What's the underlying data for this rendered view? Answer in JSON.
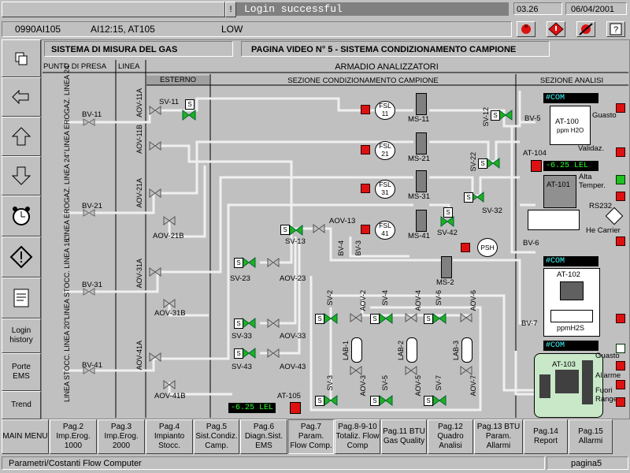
{
  "header": {
    "message": "Login successful",
    "time": "03.26",
    "date": "06/04/2001",
    "msg_marker": "!"
  },
  "alarm_row": {
    "code": "0990AI105",
    "tags": "AI12:15, AT105",
    "level": "LOW"
  },
  "titles": {
    "system": "SISTEMA DI MISURA  DEL GAS",
    "page": "PAGINA VIDEO N° 5 - SISTEMA CONDIZIONAMENTO CAMPIONE",
    "cabinet": "ARMADIO ANALIZZATORI",
    "punto": "PUNTO DI PRESA",
    "linea": "LINEA",
    "esterno": "ESTERNO",
    "sezione_cond": "SEZIONE CONDIZIONAMENTO CAMPIONE",
    "sezione_analisi": "SEZIONE ANALISI"
  },
  "lines": [
    "LINEA EROGAZ. LINEA 24\"",
    "LINEA EROGAZ. LINEA 24\"",
    "LINEA STOCC. LINEA 16\"",
    "LINEA STOCC. LINEA 20\""
  ],
  "labels": {
    "bv11": "BV-11",
    "bv21": "BV-21",
    "bv31": "BV-31",
    "bv41": "BV-41",
    "aov11a": "AOV-11A",
    "aov11b": "AOV-11B",
    "aov21a": "AOV-21A",
    "aov21b": "AOV-21B",
    "aov31a": "AOV-31A",
    "aov31b": "AOV-31B",
    "aov41a": "AOV-41A",
    "aov41b": "AOV-41B",
    "sv11": "SV-11",
    "sv13": "SV-13",
    "sv23": "SV-23",
    "sv33": "SV-33",
    "sv43": "SV-43",
    "aov23": "AOV-23",
    "aov33": "AOV-33",
    "aov43": "AOV-43",
    "aov13": "AOV-13",
    "bv4": "BV-4",
    "bv3": "BV-3",
    "fsl11": "FSL 11",
    "fsl21": "FSL 21",
    "fsl31": "FSL 31",
    "fsl41": "FSL 41",
    "ms11": "MS-11",
    "ms21": "MS-21",
    "ms31": "MS-31",
    "ms41": "MS-41",
    "ms2": "MS-2",
    "sv12": "SV-12",
    "sv22": "SV-22",
    "sv32": "SV-32",
    "sv42": "SV-42",
    "psh": "PSH",
    "sv2": "SV-2",
    "sv4": "SV-4",
    "sv6": "SV-6",
    "sv3": "SV-3",
    "sv5": "SV-5",
    "sv7": "SV-7",
    "aov2": "AOV-2",
    "aov4": "AOV-4",
    "aov6": "AOV-6",
    "aov3": "AOV-3",
    "aov5": "AOV-5",
    "aov7": "AOV-7",
    "lab1": "LAB-1",
    "lab2": "LAB-2",
    "lab3": "LAB-3",
    "at105": "AT-105",
    "at105_val": "-6.25 LEL",
    "bv5": "BV-5",
    "bv6": "BV-6",
    "bv7": "BV-7",
    "com1": "#COM",
    "com2": "#COM",
    "com3": "#COM",
    "at100": "AT-100",
    "ppmh2o": "ppm H2O",
    "guasto1": "Guasto",
    "validaz": "Validaz.",
    "at104": "AT-104",
    "at104_val": "-6.25 LEL",
    "at101": "AT-101",
    "alta_temper": "Alta Temper.",
    "rs232": "RS232",
    "he_carrier": "He Carrier",
    "at102": "AT-102",
    "ppmh2s": "ppmH2S",
    "at103": "AT-103",
    "guasto2": "Guasto",
    "allarme": "Allarme",
    "fuori_range": "Fuori Range"
  },
  "sidebar": [
    {
      "id": "copy",
      "label": "",
      "icon": "copy-icon"
    },
    {
      "id": "back",
      "label": "",
      "icon": "back-arrow-icon"
    },
    {
      "id": "up",
      "label": "",
      "icon": "up-arrow-icon"
    },
    {
      "id": "down",
      "label": "",
      "icon": "down-arrow-icon"
    },
    {
      "id": "alarm",
      "label": "",
      "icon": "alarm-clock-icon"
    },
    {
      "id": "warn",
      "label": "",
      "icon": "warning-icon"
    },
    {
      "id": "notes",
      "label": "",
      "icon": "notepad-icon"
    },
    {
      "id": "login",
      "label": "Login history",
      "icon": ""
    },
    {
      "id": "porte",
      "label": "Porte EMS",
      "icon": ""
    },
    {
      "id": "trend",
      "label": "Trend",
      "icon": ""
    }
  ],
  "nav": [
    {
      "label": "MAIN MENU"
    },
    {
      "label": "Pag.2 Imp.Erog. 1000"
    },
    {
      "label": "Pag.3 Imp.Erog. 2000"
    },
    {
      "label": "Pag.4 Impianto Stocc."
    },
    {
      "label": "Pag.5 Sist.Condiz. Camp."
    },
    {
      "label": "Pag.6 Diagn.Sist. EMS"
    },
    {
      "label": "Pag.7 Param. Flow Comp."
    },
    {
      "label": "Pag.8-9-10 Totaliz. Flow Comp"
    },
    {
      "label": "Pag.11 BTU Gas Quality"
    },
    {
      "label": "Pag.12 Quadro Analisi"
    },
    {
      "label": "Pag.13 BTU Param. Allarmi"
    },
    {
      "label": "Pag.14 Report"
    },
    {
      "label": "Pag.15 Allarmi"
    }
  ],
  "status": {
    "left": "Parametri/Costanti Flow Computer",
    "right": "pagina5"
  },
  "colors": {
    "background": "#c0c0c0",
    "pipe": "#f0f0f0",
    "alarm": "#dd1111",
    "valve_green": "#20b020",
    "display_green": "#2aff2a",
    "display_cyan": "#40ffff",
    "analyzer_panel": "#c8e8c8"
  }
}
